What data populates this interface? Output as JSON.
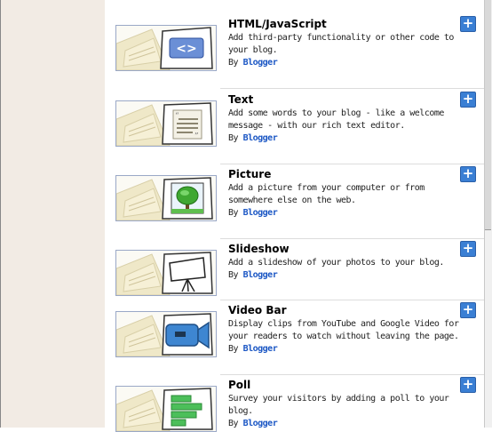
{
  "gadgets": [
    {
      "title": "HTML/JavaScript",
      "description": "Add third-party functionality or other code to your blog.",
      "by_prefix": "By",
      "by_author": "Blogger",
      "icon": "code-icon",
      "add_label": "+"
    },
    {
      "title": "Text",
      "description": "Add some words to your blog - like a welcome message - with our rich text editor.",
      "by_prefix": "By",
      "by_author": "Blogger",
      "icon": "text-document-icon",
      "add_label": "+"
    },
    {
      "title": "Picture",
      "description": "Add a picture from your computer or from somewhere else on the web.",
      "by_prefix": "By",
      "by_author": "Blogger",
      "icon": "picture-tree-icon",
      "add_label": "+"
    },
    {
      "title": "Slideshow",
      "description": "Add a slideshow of your photos to your blog.",
      "by_prefix": "By",
      "by_author": "Blogger",
      "icon": "projector-screen-icon",
      "add_label": "+"
    },
    {
      "title": "Video Bar",
      "description": "Display clips from YouTube and Google Video for your readers to watch without leaving the page.",
      "by_prefix": "By",
      "by_author": "Blogger",
      "icon": "video-camera-icon",
      "add_label": "+"
    },
    {
      "title": "Poll",
      "description": "Survey your visitors by adding a poll to your blog.",
      "by_prefix": "By",
      "by_author": "Blogger",
      "icon": "poll-bars-icon",
      "add_label": "+"
    }
  ],
  "colors": {
    "accent": "#3a7fd4",
    "author_link": "#1a56c4",
    "left_rail": "#f2ebe4"
  }
}
